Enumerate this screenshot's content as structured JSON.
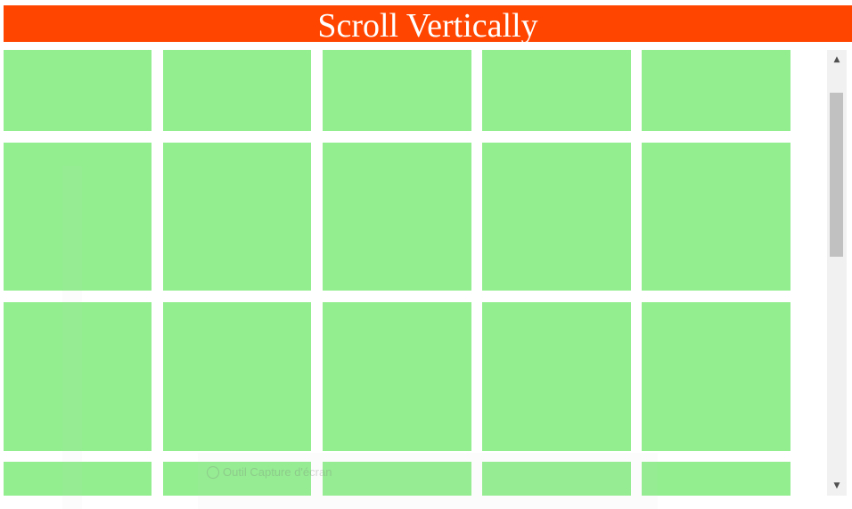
{
  "banner": {
    "title": "Scroll Vertically",
    "color": "#ff4500",
    "text_color": "#ffffff"
  },
  "grid": {
    "tile_color": "#93ee90",
    "rows": 4,
    "columns": 5
  },
  "scrollbar": {
    "up_icon": "scroll-up-arrow-icon",
    "down_icon": "scroll-down-arrow-icon",
    "up_glyph": "▲",
    "down_glyph": "▼"
  },
  "watermark": {
    "text": "Outil Capture d'écran"
  }
}
